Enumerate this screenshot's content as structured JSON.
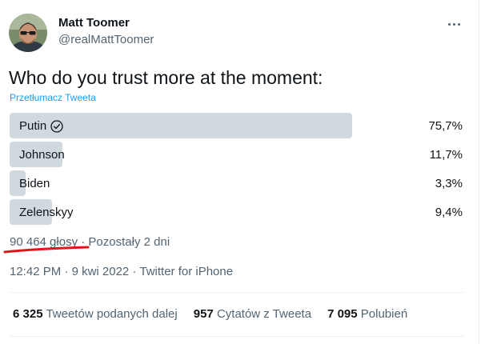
{
  "author": {
    "name": "Matt Toomer",
    "handle": "@realMattToomer"
  },
  "tweet": {
    "text": "Who do you trust more at the moment:",
    "translate_label": "Przetłumacz Tweeta"
  },
  "poll": {
    "options": [
      {
        "label": "Putin",
        "percent_text": "75,7%",
        "percent": 75.7,
        "winner": true
      },
      {
        "label": "Johnson",
        "percent_text": "11,7%",
        "percent": 11.7,
        "winner": false
      },
      {
        "label": "Biden",
        "percent_text": "3,3%",
        "percent": 3.3,
        "winner": false
      },
      {
        "label": "Zelenskyy",
        "percent_text": "9,4%",
        "percent": 9.4,
        "winner": false
      }
    ],
    "votes": "90 464 głosy",
    "separator": "·",
    "remaining": "Pozostały 2 dni"
  },
  "meta": {
    "time": "12:42 PM",
    "date": "9 kwi 2022",
    "separator": "·",
    "source": "Twitter for iPhone"
  },
  "stats": {
    "retweets_count": "6 325",
    "retweets_label": "Tweetów podanych dalej",
    "quotes_count": "957",
    "quotes_label": "Cytatów z Tweeta",
    "likes_count": "7 095",
    "likes_label": "Polubień"
  },
  "colors": {
    "poll_bar": "#cfd9de",
    "link": "#1d9bf0",
    "secondary_text": "#536471",
    "annotation": "#e0161b"
  },
  "icons": {
    "more": "more-horizontal-icon",
    "winner_check": "check-circle-icon"
  }
}
